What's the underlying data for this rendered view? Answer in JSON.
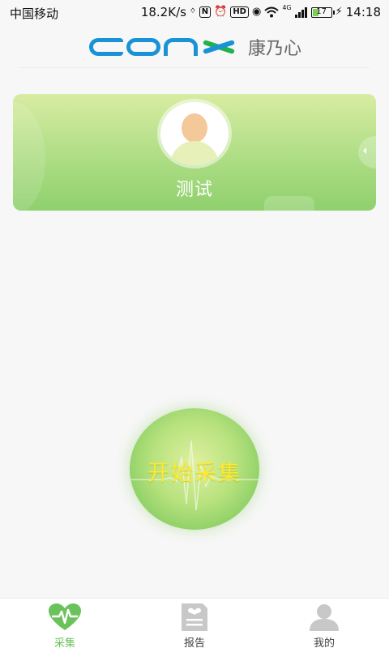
{
  "status_bar": {
    "carrier": "中国移动",
    "net_speed": "18.2K/s",
    "network_type": "4G",
    "battery_level": "17",
    "time": "14:18",
    "icons": [
      "bluetooth-icon",
      "nfc-icon",
      "alarm-icon",
      "hd-icon",
      "eye-icon",
      "wifi-icon",
      "signal-icon",
      "battery-icon"
    ]
  },
  "header": {
    "logo_text": "CONX",
    "logo_cn": "康乃心",
    "brand_blue": "#1a93d6",
    "brand_green": "#23b14d"
  },
  "profile": {
    "name": "测试",
    "avatar_icon": "user-avatar-icon"
  },
  "start_button": {
    "label": "开始采集",
    "label_color": "#ffe92e",
    "icon": "ecg-wave-icon"
  },
  "tabs": [
    {
      "label": "采集",
      "icon": "heart-pulse-icon",
      "active": true
    },
    {
      "label": "报告",
      "icon": "report-document-icon",
      "active": false
    },
    {
      "label": "我的",
      "icon": "user-profile-icon",
      "active": false
    }
  ],
  "colors": {
    "accent_green": "#6cc25a",
    "inactive_icon": "#c8c8c8"
  }
}
